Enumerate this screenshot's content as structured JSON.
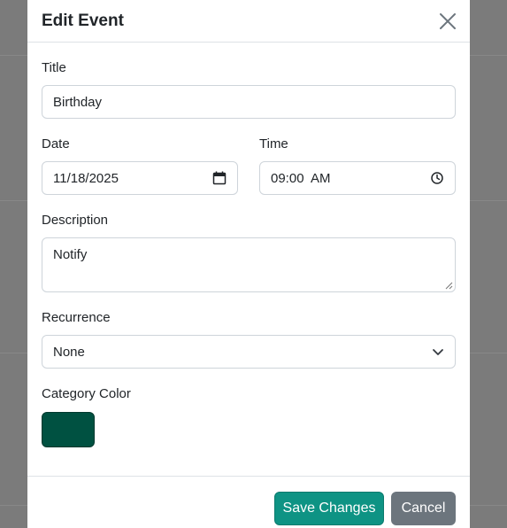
{
  "modal": {
    "title": "Edit Event",
    "close_icon": "close-icon"
  },
  "form": {
    "title_label": "Title",
    "title_value": "Birthday",
    "date_label": "Date",
    "date_value": "11/18/2025",
    "date_icon": "calendar-icon",
    "time_label": "Time",
    "time_value": "09:00  AM",
    "time_icon": "clock-icon",
    "description_label": "Description",
    "description_value": "Notify",
    "recurrence_label": "Recurrence",
    "recurrence_value": "None",
    "recurrence_icon": "chevron-down-icon",
    "color_label": "Category Color",
    "color_value": "#005141"
  },
  "footer": {
    "save_label": "Save Changes",
    "cancel_label": "Cancel",
    "save_color": "#0e9384",
    "cancel_color": "#6c757d"
  }
}
